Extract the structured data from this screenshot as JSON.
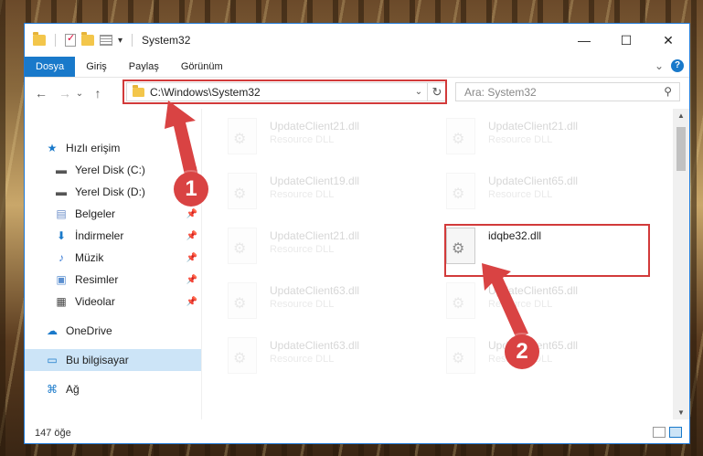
{
  "window": {
    "title": "System32"
  },
  "titlebar": {
    "minimize": "—",
    "maximize": "☐",
    "close": "✕",
    "qa_dropdown": "▾"
  },
  "ribbon": {
    "tabs": [
      "Dosya",
      "Giriş",
      "Paylaş",
      "Görünüm"
    ],
    "active_tab": "Dosya",
    "expand": "⌄",
    "help": "?"
  },
  "nav_buttons": {
    "back": "←",
    "forward": "→",
    "recent": "⌄",
    "up": "↑"
  },
  "address": {
    "path": "C:\\Windows\\System32",
    "dropdown": "⌄",
    "refresh": "↻"
  },
  "search": {
    "placeholder": "Ara: System32",
    "icon": "⚲"
  },
  "sidebar": {
    "items": [
      {
        "label": "Hızlı erişim",
        "icon": "star-icon",
        "glyph": "★",
        "color": "#1979ca"
      },
      {
        "label": "Yerel Disk (C:)",
        "icon": "drive-icon",
        "glyph": "▬",
        "color": "#555555",
        "pin": "📌"
      },
      {
        "label": "Yerel Disk (D:)",
        "icon": "drive-icon",
        "glyph": "▬",
        "color": "#555555",
        "pin": "📌"
      },
      {
        "label": "Belgeler",
        "icon": "documents-icon",
        "glyph": "▤",
        "color": "#6b8ec9",
        "pin": "📌"
      },
      {
        "label": "İndirmeler",
        "icon": "download-icon",
        "glyph": "⬇",
        "color": "#1979ca",
        "pin": "📌"
      },
      {
        "label": "Müzik",
        "icon": "music-icon",
        "glyph": "♪",
        "color": "#3a7bd5",
        "pin": "📌"
      },
      {
        "label": "Resimler",
        "icon": "pictures-icon",
        "glyph": "▣",
        "color": "#5b8fd0",
        "pin": "📌"
      },
      {
        "label": "Videolar",
        "icon": "video-icon",
        "glyph": "▦",
        "color": "#444444",
        "pin": "📌"
      },
      {
        "label": "OneDrive",
        "icon": "cloud-icon",
        "glyph": "☁",
        "color": "#1979ca"
      },
      {
        "label": "Bu bilgisayar",
        "icon": "computer-icon",
        "glyph": "▭",
        "color": "#1979ca",
        "selected": true
      },
      {
        "label": "Ağ",
        "icon": "network-icon",
        "glyph": "⌘",
        "color": "#1979ca"
      }
    ]
  },
  "files": [
    {
      "name": "UpdateClient21.dll",
      "type": "Resource DLL",
      "faded": true
    },
    {
      "name": "UpdateClient21.dll",
      "type": "Resource DLL",
      "faded": true
    },
    {
      "name": "UpdateClient19.dll",
      "type": "Resource DLL",
      "faded": true
    },
    {
      "name": "UpdateClient65.dll",
      "type": "Resource DLL",
      "faded": true
    },
    {
      "name": "UpdateClient21.dll",
      "type": "Resource DLL",
      "faded": true
    },
    {
      "name": "idqbe32.dll",
      "type": "",
      "faded": false
    },
    {
      "name": "UpdateClient63.dll",
      "type": "Resource DLL",
      "faded": true
    },
    {
      "name": "UpdateClient65.dll",
      "type": "Resource DLL",
      "faded": true
    },
    {
      "name": "UpdateClient63.dll",
      "type": "Resource DLL",
      "faded": true
    },
    {
      "name": "UpdateClient65.dll",
      "type": "Resource DLL",
      "faded": true
    }
  ],
  "status": {
    "count": "147 öğe"
  },
  "annotations": {
    "marker1": "1",
    "marker2": "2",
    "highlight_color": "#d23a3a"
  },
  "scrollbar": {
    "up": "▲",
    "down": "▼"
  }
}
